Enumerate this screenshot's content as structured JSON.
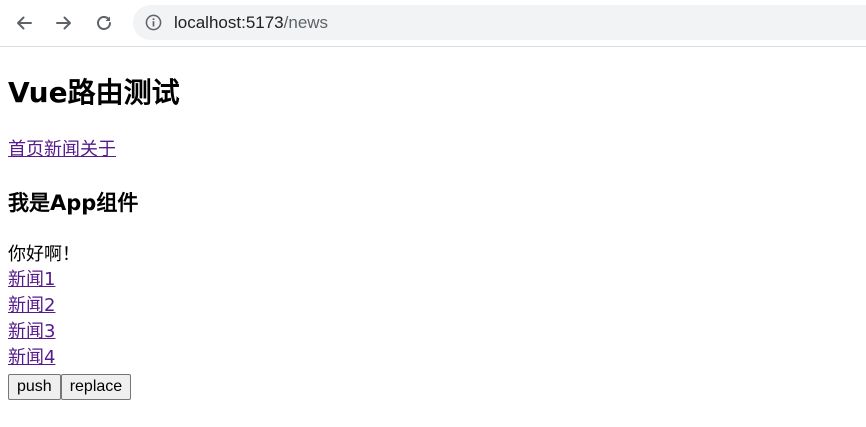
{
  "browser": {
    "url_host": "localhost:5173",
    "url_path": "/news",
    "icons": {
      "back": "arrow-left-icon",
      "forward": "arrow-right-icon",
      "reload": "reload-icon",
      "info": "info-circle-icon"
    }
  },
  "page": {
    "title": "Vue路由测试",
    "nav_links": [
      "首页",
      "新闻",
      "关于"
    ],
    "component_heading": "我是App组件",
    "greeting": "你好啊！",
    "news_items": [
      "新闻1",
      "新闻2",
      "新闻3",
      "新闻4"
    ],
    "buttons": {
      "push": "push",
      "replace": "replace"
    }
  },
  "colors": {
    "visited_link": "#551a8b",
    "omnibox_bg": "#f1f3f4"
  }
}
